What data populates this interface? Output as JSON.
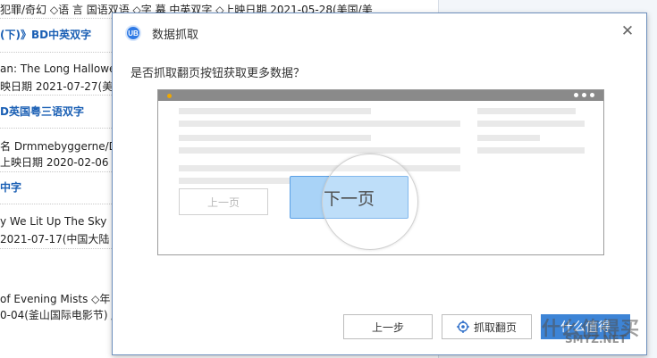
{
  "background_page": {
    "lines": [
      {
        "text": "犯罪/奇幻 ◇语 言 国语双语 ◇字 幕 中英双字 ◇上映日期 2021-05-28(美国/美",
        "style": "dark"
      },
      {
        "text": "(下)》BD中英双字",
        "style": "blue"
      },
      {
        "text": "an: The Long Hallowe",
        "style": "dark"
      },
      {
        "text": "映日期 2021-07-27(美",
        "style": "dark"
      },
      {
        "text": "D英国粤三语双字",
        "style": "blue"
      },
      {
        "text": "名 Drmmebyggerne/D",
        "style": "dark"
      },
      {
        "text": "上映日期 2020-02-06",
        "style": "dark"
      },
      {
        "text": "中字",
        "style": "blue"
      },
      {
        "text": "y We Lit Up The Sky",
        "style": "dark"
      },
      {
        "text": "2021-07-17(中国大陆",
        "style": "dark"
      },
      {
        "text": "of Evening Mists ◇年",
        "style": "dark"
      },
      {
        "text": "0-04(釜山国际电影节) /",
        "style": "dark"
      }
    ]
  },
  "dialog": {
    "title": "数据抓取",
    "logo_text": "UB",
    "close_icon": "close-icon",
    "question": "是否抓取翻页按钮获取更多数据？",
    "illustration": {
      "prev_label": "上一页",
      "next_label": "下一页"
    },
    "buttons": {
      "back": "上一步",
      "capture": "抓取翻页",
      "finish": "什么值得"
    }
  },
  "watermark": {
    "main": "什么值得买",
    "sub": "SMYZ.NET"
  },
  "colors": {
    "accent": "#3d84d6",
    "link_blue": "#1a5fb4",
    "next_button_fill": "#a9d3f7"
  }
}
